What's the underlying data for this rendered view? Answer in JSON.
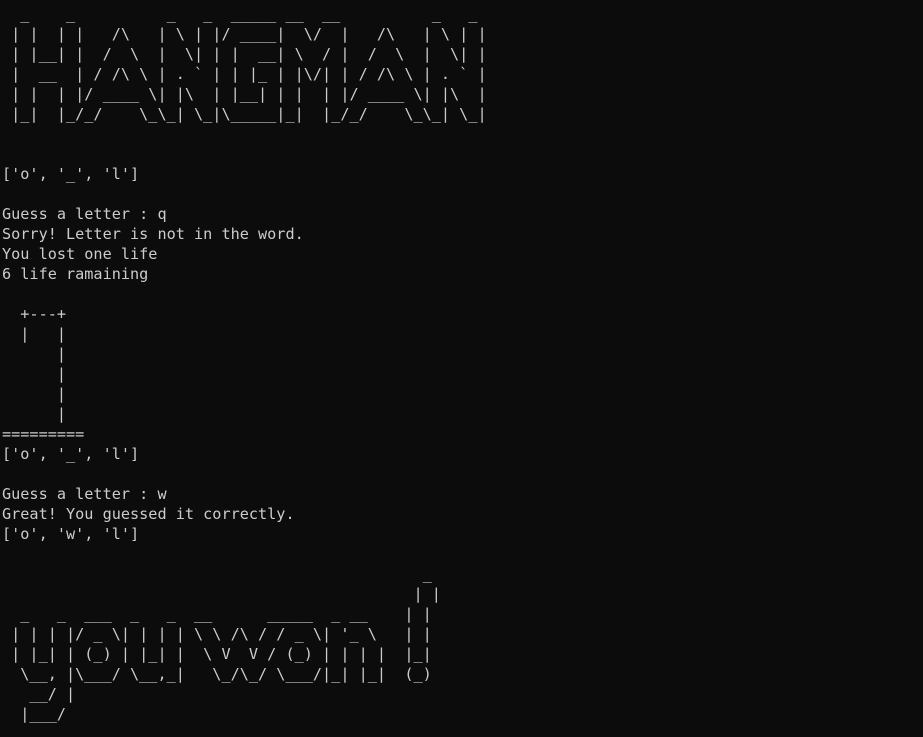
{
  "console": {
    "banner": [
      "  _    _          _   _  _____ __  __          _   _ ",
      " | |  | |   /\\   | \\ | |/ ____|  \\/  |   /\\   | \\ | |",
      " | |__| |  /  \\  |  \\| | |  __| \\  / |  /  \\  |  \\| |",
      " |  __  | / /\\ \\ | . ` | | |_ | |\\/| | / /\\ \\ | . ` |",
      " | |  | |/ ____ \\| |\\  | |__| | |  | |/ ____ \\| |\\  |",
      " |_|  |_/_/    \\_\\_| \\_|\\_____|_|  |_/_/    \\_\\_| \\_|"
    ],
    "round1": {
      "word_state": "['o', '_', 'l']",
      "prompt": "Guess a letter : q",
      "feedback": "Sorry! Letter is not in the word.",
      "lost": "You lost one life",
      "remaining": "6 life ramaining"
    },
    "gallows": [
      "  +---+",
      "  |   |",
      "      |",
      "      |",
      "      |",
      "      |",
      "========="
    ],
    "round2": {
      "word_state": "['o', '_', 'l']",
      "prompt": "Guess a letter : w",
      "feedback": "Great! You guessed it correctly.",
      "final_state": "['o', 'w', 'l']"
    },
    "win_banner": [
      "                                              _ ",
      "                                             | |",
      "  _   _  ___  _   _  __      _____  _ __    | |",
      " | | | |/ _ \\| | | | \\ \\ /\\ / / _ \\| '_ \\   | |",
      " | |_| | (_) | |_| |  \\ V  V / (_) | | | |  |_|",
      "  \\__, |\\___/ \\__,_|   \\_/\\_/ \\___/|_| |_|  (_)",
      "   __/ |",
      "  |___/"
    ]
  }
}
